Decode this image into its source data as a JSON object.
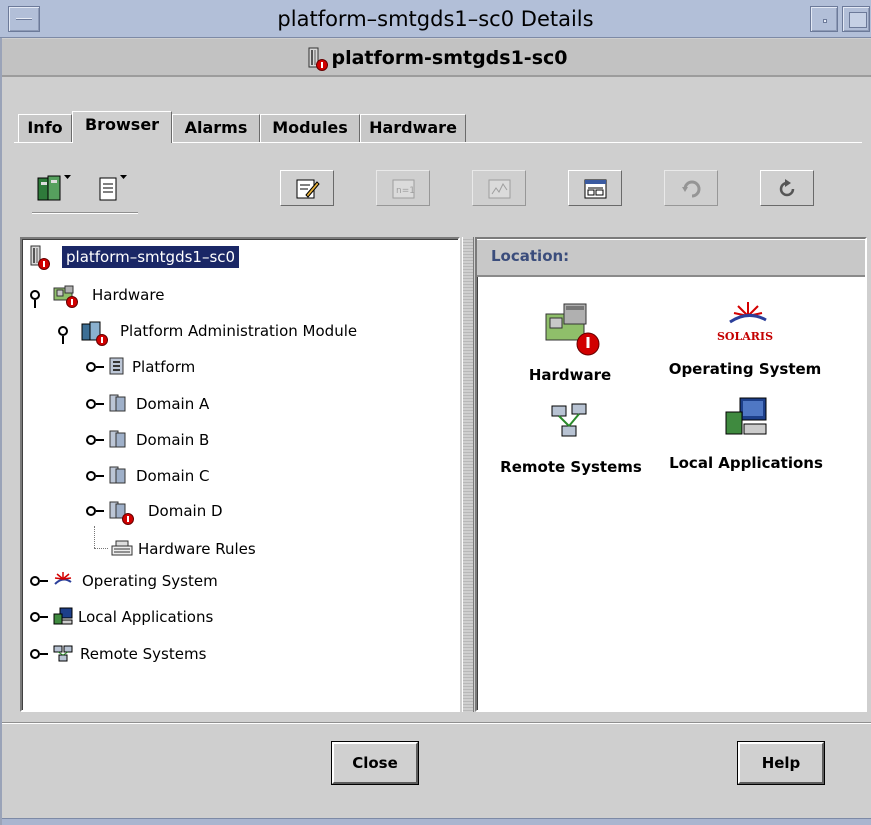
{
  "window": {
    "title": "platform–smtgds1–sc0 Details",
    "header": "platform-smtgds1-sc0"
  },
  "tabs": [
    {
      "label": "Info",
      "active": false
    },
    {
      "label": "Browser",
      "active": true
    },
    {
      "label": "Alarms",
      "active": false
    },
    {
      "label": "Modules",
      "active": false
    },
    {
      "label": "Hardware",
      "active": false
    }
  ],
  "toolbar": {
    "icons": [
      "server-menu-icon",
      "document-menu-icon",
      "edit-icon",
      "n-equals-1-icon",
      "graph-icon",
      "window-view-icon",
      "refresh-alt-icon",
      "reload-icon"
    ]
  },
  "tree": {
    "root": "platform–smtgds1–sc0",
    "hardware": "Hardware",
    "platform_admin": "Platform Administration Module",
    "platform": "Platform",
    "domain_a": "Domain A",
    "domain_b": "Domain B",
    "domain_c": "Domain C",
    "domain_d": "Domain D",
    "hardware_rules": "Hardware Rules",
    "operating_system": "Operating System",
    "local_applications": "Local Applications",
    "remote_systems": "Remote Systems"
  },
  "location": {
    "label": "Location:",
    "items": {
      "hardware": "Hardware",
      "operating_system": "Operating System",
      "remote_systems": "Remote Systems",
      "local_applications": "Local Applications",
      "solaris_logo_text": "SOLARIS"
    }
  },
  "buttons": {
    "close": "Close",
    "help": "Help"
  },
  "colors": {
    "titlebar": "#b2bfd8",
    "selection": "#1a2766",
    "alarm": "#d10000",
    "location_label": "#3b4d7c"
  }
}
